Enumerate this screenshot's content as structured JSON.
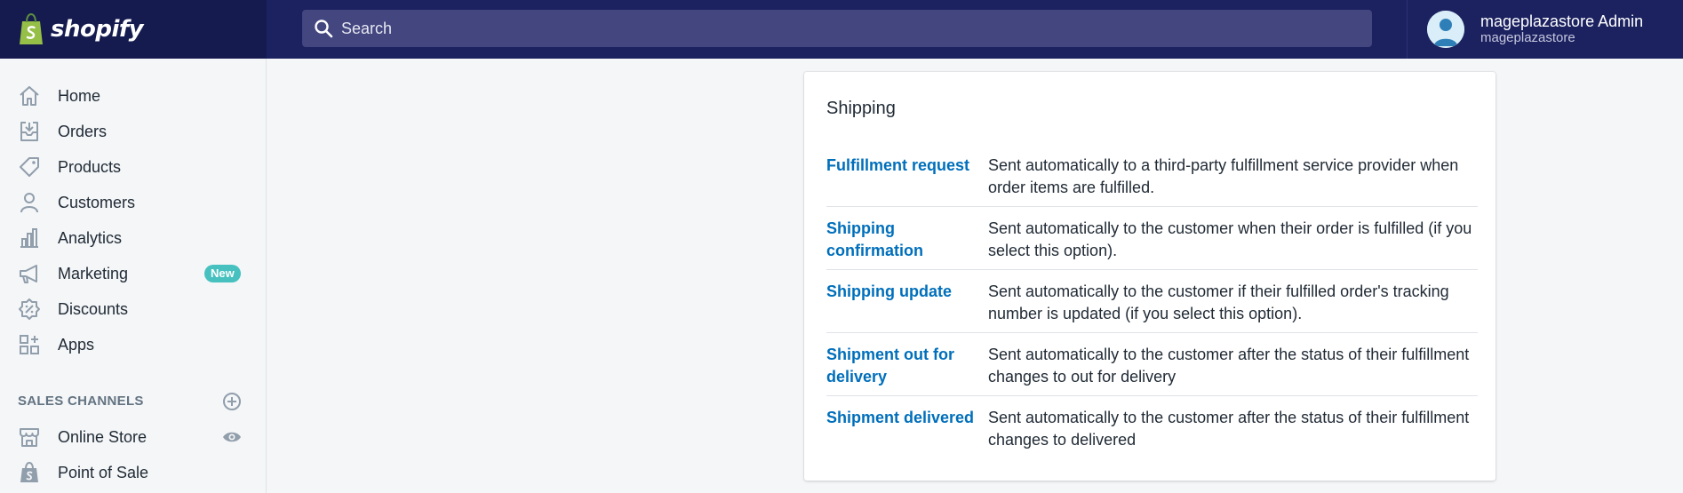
{
  "brand": {
    "name": "shopify"
  },
  "search": {
    "placeholder": "Search"
  },
  "user": {
    "name": "mageplazastore Admin",
    "store": "mageplazastore"
  },
  "sidebar": {
    "items": [
      {
        "label": "Home",
        "icon": "home-icon"
      },
      {
        "label": "Orders",
        "icon": "orders-icon"
      },
      {
        "label": "Products",
        "icon": "tag-icon"
      },
      {
        "label": "Customers",
        "icon": "person-icon"
      },
      {
        "label": "Analytics",
        "icon": "bar-chart-icon"
      },
      {
        "label": "Marketing",
        "icon": "megaphone-icon",
        "badge": "New"
      },
      {
        "label": "Discounts",
        "icon": "discount-icon"
      },
      {
        "label": "Apps",
        "icon": "apps-icon"
      }
    ],
    "sales_channels_title": "SALES CHANNELS",
    "channels": [
      {
        "label": "Online Store",
        "icon": "store-icon"
      },
      {
        "label": "Point of Sale",
        "icon": "shopify-bag-icon"
      }
    ]
  },
  "card": {
    "title": "Shipping",
    "rows": [
      {
        "name": "Fulfillment request",
        "description": "Sent automatically to a third-party fulfillment service provider when order items are fulfilled."
      },
      {
        "name": "Shipping confirmation",
        "description": "Sent automatically to the customer when their order is fulfilled (if you select this option)."
      },
      {
        "name": "Shipping update",
        "description": "Sent automatically to the customer if their fulfilled order's tracking number is updated (if you select this option)."
      },
      {
        "name": "Shipment out for delivery",
        "description": "Sent automatically to the customer after the status of their fulfillment changes to out for delivery"
      },
      {
        "name": "Shipment delivered",
        "description": "Sent automatically to the customer after the status of their fulfillment changes to delivered"
      }
    ]
  },
  "colors": {
    "topbar": "#1c2260",
    "link": "#006fbb",
    "badge": "#47c1bf"
  }
}
